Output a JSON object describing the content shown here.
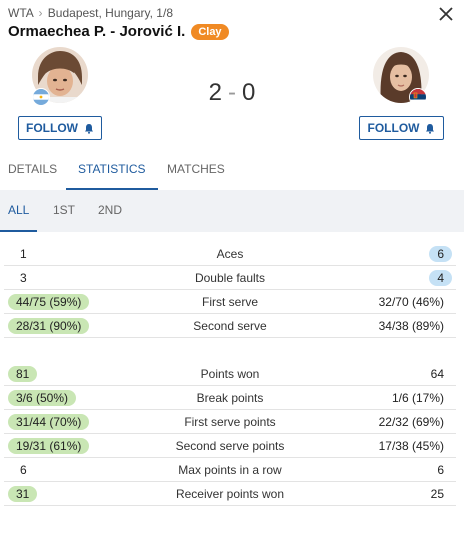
{
  "breadcrumb": {
    "sport": "WTA",
    "tournament": "Budapest, Hungary, 1/8"
  },
  "match": {
    "title": "Ormaechea P. - Jorović I.",
    "surface": "Clay",
    "score_home": "2",
    "score_sep": "-",
    "score_away": "0"
  },
  "players": [
    {
      "flag": "argentina-flag",
      "follow_label": "FOLLOW"
    },
    {
      "flag": "serbia-flag",
      "follow_label": "FOLLOW"
    }
  ],
  "tabs": [
    {
      "label": "DETAILS",
      "active": false
    },
    {
      "label": "STATISTICS",
      "active": true
    },
    {
      "label": "MATCHES",
      "active": false
    }
  ],
  "subtabs": [
    {
      "label": "ALL",
      "active": true
    },
    {
      "label": "1ST",
      "active": false
    },
    {
      "label": "2ND",
      "active": false
    }
  ],
  "stats": [
    {
      "home": "1",
      "label": "Aces",
      "away": "6",
      "winner": "away"
    },
    {
      "home": "3",
      "label": "Double faults",
      "away": "4",
      "winner": "away"
    },
    {
      "home": "44/75 (59%)",
      "label": "First serve",
      "away": "32/70 (46%)",
      "winner": "home"
    },
    {
      "home": "28/31 (90%)",
      "label": "Second serve",
      "away": "34/38 (89%)",
      "winner": "home"
    },
    {
      "home": "81",
      "label": "Points won",
      "away": "64",
      "winner": "home"
    },
    {
      "home": "3/6 (50%)",
      "label": "Break points",
      "away": "1/6 (17%)",
      "winner": "home"
    },
    {
      "home": "31/44 (70%)",
      "label": "First serve points",
      "away": "22/32 (69%)",
      "winner": "home"
    },
    {
      "home": "19/31 (61%)",
      "label": "Second serve points",
      "away": "17/38 (45%)",
      "winner": "home"
    },
    {
      "home": "6",
      "label": "Max points in a row",
      "away": "6",
      "winner": "none"
    },
    {
      "home": "31",
      "label": "Receiver points won",
      "away": "25",
      "winner": "home"
    }
  ],
  "colors": {
    "accent": "#1f5b9e",
    "surface_badge": "#f08a24",
    "home_highlight": "#c9e6b4",
    "away_highlight": "#c5e1f5"
  }
}
